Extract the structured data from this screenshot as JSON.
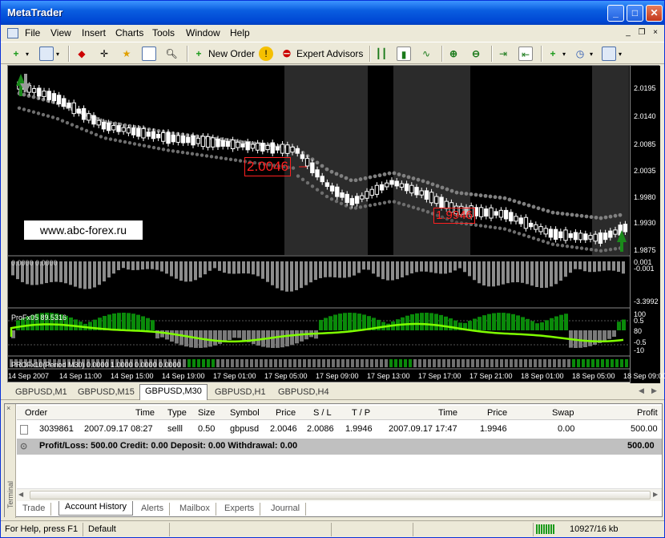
{
  "app": {
    "title": "MetaTrader"
  },
  "menu": [
    "File",
    "View",
    "Insert",
    "Charts",
    "Tools",
    "Window",
    "Help"
  ],
  "toolbar": {
    "new_order": "New Order",
    "expert_advisors": "Expert Advisors"
  },
  "chart": {
    "watermark": "www.abc-forex.ru",
    "price_labels": [
      "2.0195",
      "2.0140",
      "2.0085",
      "2.0035",
      "1.9980",
      "1.9930",
      "1.9875"
    ],
    "sub1_labels": [
      "0.001",
      "-0.001",
      "-3.3992"
    ],
    "sub2_labels": [
      "100",
      "0.5",
      "80",
      "-0.5",
      "-10"
    ],
    "sub1_name": "0.0000 0.0000",
    "sub2_name": "ProFx05 89.5316",
    "sub3_name": "PROFx10(Period M30) 0.0000 1.0000 0.0000 0.0000",
    "time_labels": [
      "14 Sep 2007",
      "14 Sep 11:00",
      "14 Sep 15:00",
      "14 Sep 19:00",
      "17 Sep 01:00",
      "17 Sep 05:00",
      "17 Sep 09:00",
      "17 Sep 13:00",
      "17 Sep 17:00",
      "17 Sep 21:00",
      "18 Sep 01:00",
      "18 Sep 05:00",
      "18 Sep 09:00"
    ],
    "sell_box": "2.0046",
    "tp_box": "1.9946"
  },
  "chart_tabs": [
    "GBPUSD,M1",
    "GBPUSD,M15",
    "GBPUSD,M30",
    "GBPUSD,H1",
    "GBPUSD,H4"
  ],
  "active_chart_tab": "GBPUSD,M30",
  "terminal": {
    "side_label": "Terminal",
    "columns": [
      "Order",
      "Time",
      "Type",
      "Size",
      "Symbol",
      "Price",
      "S / L",
      "T / P",
      "Time",
      "Price",
      "Swap",
      "Profit"
    ],
    "rows": [
      {
        "order": "3039861",
        "time": "2007.09.17 08:27",
        "type": "selll",
        "size": "0.50",
        "symbol": "gbpusd",
        "price": "2.0046",
        "sl": "2.0086",
        "tp": "1.9946",
        "close_time": "2007.09.17 17:47",
        "close_price": "1.9946",
        "swap": "0.00",
        "profit": "500.00"
      }
    ],
    "total_text": "Profit/Loss: 500.00  Credit: 0.00  Deposit: 0.00  Withdrawal: 0.00",
    "total_profit": "500.00",
    "tabs": [
      "Trade",
      "Account History",
      "Alerts",
      "Mailbox",
      "Experts",
      "Journal"
    ],
    "active_tab": "Account History"
  },
  "status": {
    "help": "For Help, press F1",
    "profile": "Default",
    "traffic": "10927/16 kb"
  },
  "colors": {
    "title_bar": "#0a5ee0",
    "chart_bg": "#000000",
    "candle": "#ffffff",
    "ma": "#808080",
    "green": "#00a000",
    "red": "#ff2020",
    "lime": "#7fff00"
  }
}
